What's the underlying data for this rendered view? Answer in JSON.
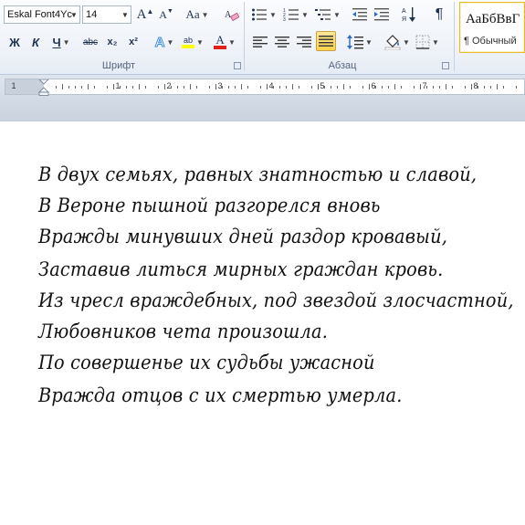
{
  "ribbon": {
    "font_group": {
      "label": "Шрифт",
      "font_name": "Eskal Font4Yc",
      "font_size": "14",
      "grow_font": "A",
      "shrink_font": "A",
      "change_case": "Aa",
      "bold": "Ж",
      "italic": "К",
      "underline": "Ч",
      "strikethrough": "abc",
      "subscript": "x₂",
      "superscript": "x²",
      "text_effects": "A",
      "highlight": "ab",
      "font_color": "A"
    },
    "paragraph_group": {
      "label": "Абзац",
      "pilcrow": "¶"
    },
    "styles": {
      "sample": "АаБбВвГ",
      "name": "¶ Обычный"
    },
    "colors": {
      "accent_highlight": "#ffd34a",
      "font_color_bar": "#e0201b",
      "highlight_bar": "#ffff00",
      "text_effects": "#3c8de0"
    }
  },
  "ruler": {
    "numbers": [
      "1",
      "1",
      "2",
      "3",
      "4",
      "5",
      "6",
      "7",
      "8"
    ]
  },
  "document": {
    "lines": [
      "В двух семьях, равных знатностью и славой,",
      "В Вероне пышной разгорелся вновь",
      "Вражды минувших дней раздор кровавый,",
      "Заставив литься мирных граждан кровь.",
      "Из чресл враждебных, под звездой злосчастной,",
      "Любовников чета произошла.",
      "По совершенье их судьбы ужасной",
      "Вражда отцов с их смертью умерла."
    ]
  }
}
